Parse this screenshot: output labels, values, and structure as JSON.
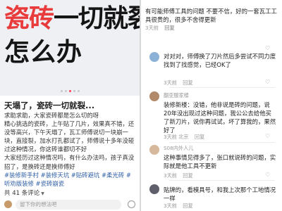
{
  "cover": {
    "line1_red": "瓷砖",
    "line1_black": "一切就裂",
    "line2": "怎么办"
  },
  "post": {
    "title": "天塌了，瓷砖一切就裂...",
    "body": [
      "求助求助，大家瓷砖都是怎么切的呀",
      "精心挑选的瓷砖，上午贴了几片，效果真不错，还没等高兴，下午天塌了，瓦工师傅说切一块崩一块，直接裂，加水打孔都试了，师傅说十多年没碰过这种情况，你这砖谁都切不好",
      "大家经历过这种情况吗，有什么办法吗，孩子真没招了，是换砖还是换师傅好"
    ],
    "tags": [
      "#装修新手村",
      "#装修天坑",
      "#贴砖避坑",
      "#柔光砖",
      "#听劝版装修",
      "#瓷砖崩瓷"
    ],
    "comments_count": "共 41 条评论",
    "comment_placeholder": "留下你的想法吧"
  },
  "right": {
    "top_text": "有可能师傅工具的问题 不要不信，好的一套瓦工工具很贵的，很多不舍得更新",
    "top_meta": "3天前",
    "reply": "回复",
    "c1_text": "对对对，师傅换了刀片然后多尝试不同力度找到了找感觉，已经OK了",
    "c1_meta": "3天前",
    "c2_name": "翻亚服家楼",
    "c2_text": "装修新楼：没错，他非说是砖的问题，说20年没出现过这种问题，我公公去给他买了新刀片，说你再试试，坏了算我的，果然好了",
    "c2_meta": "3天前 北京",
    "c3_name": "S08内外人儿",
    "c3_text": "这种事情见得多了，张口就说砖的问题，实际就是他工具不更新",
    "c3_meta": "3天前",
    "c4_text": "贴牌的，看模具号，和我上次那个工地情况一样",
    "c4_meta": "3天前"
  },
  "colors": {
    "accent_red": "#e93b3b",
    "tag_blue": "#2f5fa6"
  }
}
